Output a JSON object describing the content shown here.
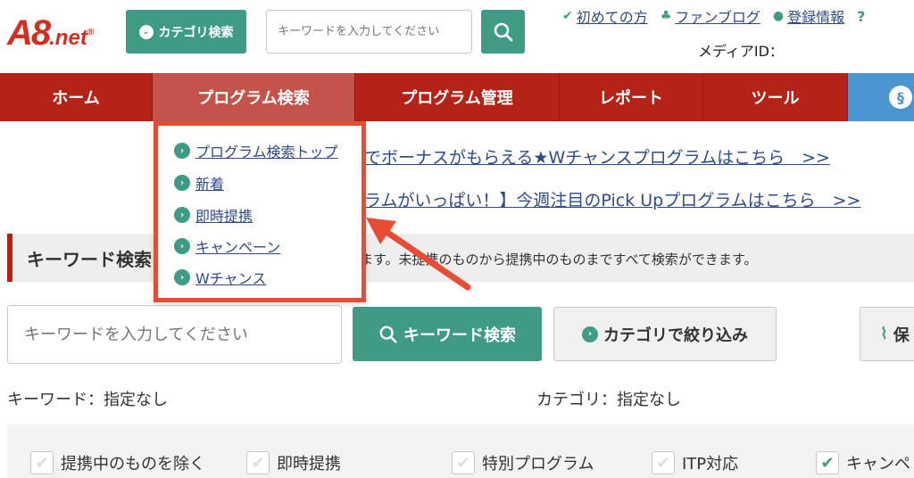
{
  "header": {
    "logo": {
      "main": "A8",
      "suffix": ".net",
      "reg": "®"
    },
    "category_search_label": "カテゴリ検索",
    "keyword_placeholder": "キーワードを入力してください",
    "links": [
      {
        "label": "初めての方",
        "icon": "leaf-icon"
      },
      {
        "label": "ファンブログ",
        "icon": "people-icon"
      },
      {
        "label": "登録情報",
        "icon": "user-icon"
      },
      {
        "label": "?",
        "icon": "help-icon"
      }
    ],
    "media_id_label": "メディアID："
  },
  "nav": {
    "items": [
      {
        "label": "ホーム"
      },
      {
        "label": "プログラム検索",
        "active": true
      },
      {
        "label": "プログラム管理"
      },
      {
        "label": "レポート"
      },
      {
        "label": "ツール"
      }
    ]
  },
  "dropdown": {
    "items": [
      {
        "label": "プログラム検索トップ"
      },
      {
        "label": "新着"
      },
      {
        "label": "即時提携"
      },
      {
        "label": "キャンペーン"
      },
      {
        "label": "Wチャンス"
      }
    ]
  },
  "banners": [
    {
      "text": "でボーナスがもらえる★Wチャンスプログラムはこちら　>>"
    },
    {
      "text": "ラムがいっぱい！】今週注目のPick Upプログラムはこちら　>>"
    }
  ],
  "keyword_section": {
    "title": "キーワード検索",
    "description": "きます。未提携のものから提携中のものまですべて検索ができます。"
  },
  "search": {
    "placeholder": "キーワードを入力してください",
    "search_button": "キーワード検索",
    "category_filter_button": "カテゴリで絞り込み",
    "save_button": "保"
  },
  "conditions": {
    "keyword": "キーワード：指定なし",
    "category": "カテゴリ：指定なし"
  },
  "filters": [
    {
      "label": "提携中のものを除く",
      "checked": false
    },
    {
      "label": "即時提携",
      "checked": false
    },
    {
      "label": "特別プログラム",
      "checked": false
    },
    {
      "label": "ITP対応",
      "checked": false
    },
    {
      "label": "キャンペ",
      "checked": true
    }
  ],
  "colors": {
    "brand_red": "#b52318",
    "accent_green": "#3f9a86",
    "link_blue": "#2d4a8a",
    "highlight": "#e84c33"
  }
}
